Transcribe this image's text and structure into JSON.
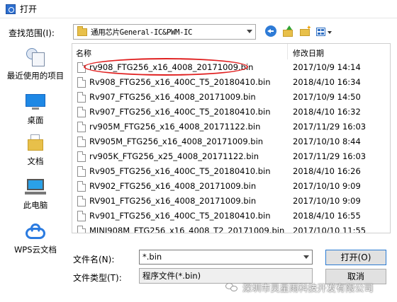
{
  "window": {
    "title": "打开"
  },
  "lookin": {
    "label": "查找范围(I):",
    "value": "通用芯片General-IC&PWM-IC"
  },
  "places": [
    {
      "label": "最近使用的项目",
      "icon": "recent-items-icon"
    },
    {
      "label": "桌面",
      "icon": "desktop-icon"
    },
    {
      "label": "文档",
      "icon": "documents-folder-icon"
    },
    {
      "label": "此电脑",
      "icon": "this-pc-icon"
    },
    {
      "label": "WPS云文档",
      "icon": "wps-cloud-icon"
    }
  ],
  "list": {
    "columns": {
      "name": "名称",
      "date": "修改日期"
    },
    "files": [
      {
        "name": "rv908_FTG256_x16_4008_20171009.bin",
        "date": "2017/10/9 14:14"
      },
      {
        "name": "Rv908_FTG256_x16_400C_T5_20180410.bin",
        "date": "2018/4/10 16:34"
      },
      {
        "name": "Rv907_FTG256_x16_4008_20171009.bin",
        "date": "2017/10/9 14:50"
      },
      {
        "name": "Rv907_FTG256_x16_400C_T5_20180410.bin",
        "date": "2018/4/10 16:32"
      },
      {
        "name": "rv905M_FTG256_x16_4008_20171122.bin",
        "date": "2017/11/29 16:03"
      },
      {
        "name": "RV905M_FTG256_x16_4008_20171009.bin",
        "date": "2017/10/10 8:44"
      },
      {
        "name": "rv905K_FTG256_x25_4008_20171122.bin",
        "date": "2017/11/29 16:03"
      },
      {
        "name": "Rv905_FTG256_x16_400C_T5_20180410.bin",
        "date": "2018/4/10 16:26"
      },
      {
        "name": "RV902_FTG256_x16_4008_20171009.bin",
        "date": "2017/10/10 9:09"
      },
      {
        "name": "RV901_FTG256_x16_4008_20171009.bin",
        "date": "2017/10/10 9:09"
      },
      {
        "name": "Rv901_FTG256_x16_400C_T5_20180410.bin",
        "date": "2018/4/10 16:55"
      },
      {
        "name": "MINI908M_FTG256_x16_4008_T2_20171009.bin",
        "date": "2017/10/10 11:55"
      }
    ]
  },
  "filename": {
    "label": "文件名(N):",
    "value": "*.bin"
  },
  "filetype": {
    "label": "文件类型(T):",
    "value": "程序文件(*.bin)"
  },
  "buttons": {
    "open": "打开(O)",
    "cancel": "取消"
  },
  "watermark": {
    "text": "深圳市灵星雨科技开发有限公司"
  },
  "colors": {
    "highlight_ellipse": "#e02020",
    "accent": "#2a7ad2"
  }
}
